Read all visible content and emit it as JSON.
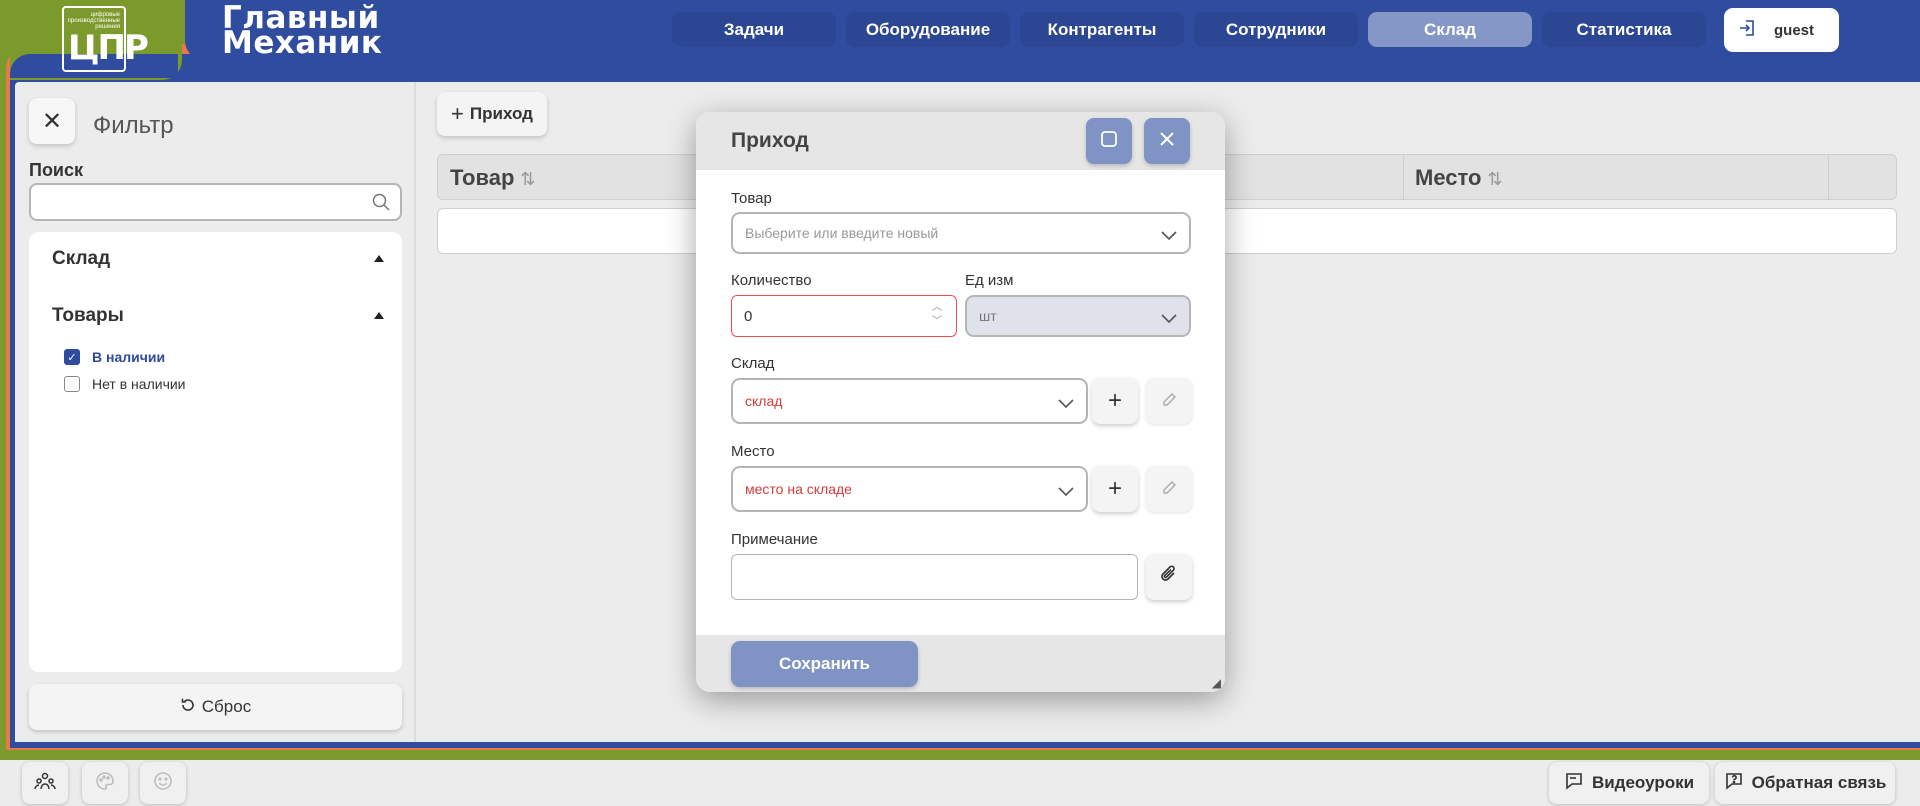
{
  "brand": {
    "logo_small": "цифровые производственные решения",
    "logo_big": "ЦПР",
    "line1": "Главный",
    "line2": "Механик"
  },
  "nav": {
    "tabs": [
      {
        "label": "Задачи"
      },
      {
        "label": "Оборудование"
      },
      {
        "label": "Контрагенты"
      },
      {
        "label": "Сотрудники"
      },
      {
        "label": "Склад",
        "active": true
      },
      {
        "label": "Статистика"
      }
    ],
    "user": "guest"
  },
  "sidebar": {
    "filter_title": "Фильтр",
    "search_label": "Поиск",
    "search_value": "",
    "sections": [
      {
        "title": "Склад"
      },
      {
        "title": "Товары"
      }
    ],
    "checkboxes": [
      {
        "label": "В наличии",
        "checked": true
      },
      {
        "label": "Нет в наличии",
        "checked": false
      }
    ],
    "reset_label": "Сброс"
  },
  "content": {
    "income_button": "Приход",
    "columns": [
      {
        "label": "Товар"
      },
      {
        "label": "Место"
      }
    ]
  },
  "modal": {
    "title": "Приход",
    "product_label": "Товар",
    "product_placeholder": "Выберите или введите новый",
    "qty_label": "Количество",
    "qty_value": "0",
    "unit_label": "Ед изм",
    "unit_value": "шт",
    "warehouse_label": "Склад",
    "warehouse_value": "склад",
    "place_label": "Место",
    "place_value": "место на складе",
    "note_label": "Примечание",
    "save_label": "Сохранить"
  },
  "bottom": {
    "video_label": "Видеоуроки",
    "feedback_label": "Обратная связь"
  },
  "colors": {
    "brand_blue": "#2f4c9e",
    "accent_green": "#7c9a2c",
    "accent_orange": "#e87a4a",
    "active_tab": "#8497c7",
    "error_red": "#e85050"
  }
}
